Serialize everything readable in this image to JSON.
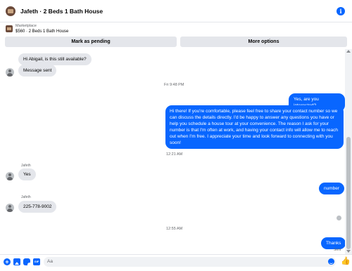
{
  "header": {
    "title": "Jafeth · 2 Beds 1 Bath House",
    "info_icon": "info-icon"
  },
  "listing": {
    "category": "Marketplace",
    "title": "$560 · 2 Beds 1 Bath House"
  },
  "actions": {
    "pending_label": "Mark as pending",
    "more_label": "More options"
  },
  "messages": {
    "m1": "Hi Abigail, is this still available?",
    "m2": "Message sent",
    "ts1": "Fri 9:48 PM",
    "m3": "Yes, are you interested?",
    "m4": "Hi there! If you're comfortable, please feel free to share your contact number so we can discuss the details directly. I'd be happy to answer any questions you have or help you schedule a house tour at your convenience. The reason I ask for your number is that I'm often at work, and having your contact info will allow me to reach out when I'm free. I appreciate your time and look forward to connecting with you soon!",
    "ts2": "12:21 AM",
    "sender1": "Jafeth",
    "m5": "Yes",
    "m6": "number",
    "sender2": "Jafeth",
    "m7": "225-778-9002",
    "ts3": "12:55 AM",
    "m8": "Thanks",
    "status": "Sent"
  },
  "composer": {
    "placeholder": "Aa"
  },
  "colors": {
    "accent": "#0866ff",
    "bubble_in": "#e4e6eb"
  }
}
